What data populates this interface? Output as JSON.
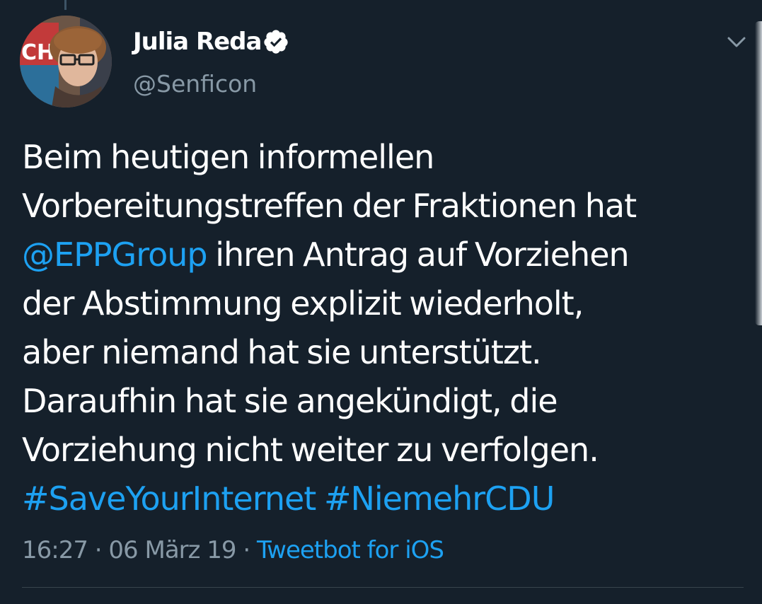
{
  "tweet": {
    "author": {
      "display_name": "Julia Reda",
      "handle": "@Senficon",
      "verified": true,
      "avatar_sign_text": "CH"
    },
    "text_lines": [
      [
        {
          "text": "Beim heutigen informellen",
          "type": "text"
        }
      ],
      [
        {
          "text": "Vorbereitungstreffen der Fraktionen hat",
          "type": "text"
        }
      ],
      [
        {
          "text": "@EPPGroup",
          "type": "mention"
        },
        {
          "text": " ihren Antrag auf Vorziehen",
          "type": "text"
        }
      ],
      [
        {
          "text": "der Abstimmung explizit wiederholt,",
          "type": "text"
        }
      ],
      [
        {
          "text": "aber niemand hat sie unterstützt.",
          "type": "text"
        }
      ],
      [
        {
          "text": "Daraufhin hat sie angekündigt, die",
          "type": "text"
        }
      ],
      [
        {
          "text": "Vorziehung nicht weiter zu verfolgen.",
          "type": "text"
        }
      ],
      [
        {
          "text": "#SaveYourInternet",
          "type": "hashtag"
        },
        {
          "text": " ",
          "type": "text"
        },
        {
          "text": "#NiemehrCDU",
          "type": "hashtag"
        }
      ]
    ],
    "meta": {
      "time": "16:27",
      "separator": " · ",
      "date": "06 März 19",
      "source": "Tweetbot for iOS"
    }
  },
  "icons": {
    "verified": "verified-badge-icon",
    "caret": "chevron-down-icon"
  },
  "colors": {
    "background": "#15202b",
    "text": "#ffffff",
    "secondary": "#8899a6",
    "link": "#1da1f2",
    "divider": "#38444d"
  }
}
